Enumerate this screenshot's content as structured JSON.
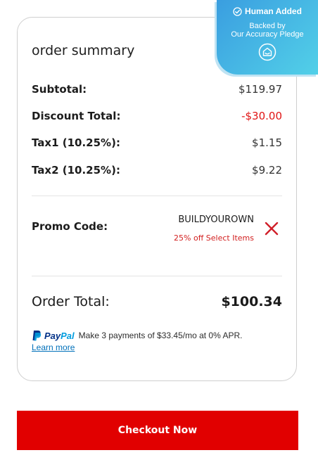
{
  "summary": {
    "title": "order summary",
    "subtotal_label": "Subtotal:",
    "subtotal_value": "$119.97",
    "discount_label": "Discount Total:",
    "discount_value": "-$30.00",
    "tax1_label": "Tax1 (10.25%):",
    "tax1_value": "$1.15",
    "tax2_label": "Tax2 (10.25%):",
    "tax2_value": "$9.22"
  },
  "promo": {
    "label": "Promo Code:",
    "code": "BUILDYOUROWN",
    "description": "25% off Select Items",
    "remove_icon": "close-icon"
  },
  "total": {
    "label": "Order Total:",
    "value": "$100.34"
  },
  "paypal": {
    "brand_part1": "Pay",
    "brand_part2": "Pal",
    "message": "Make 3 payments of $33.45/mo at 0% APR.",
    "learn_more": "Learn more"
  },
  "checkout": {
    "label": "Checkout Now"
  },
  "badge": {
    "title": "Human Added",
    "line1": "Backed by",
    "line2": "Our Accuracy Pledge"
  },
  "colors": {
    "accent_red": "#e10000",
    "discount_red": "#e01414",
    "badge_blue": "#3a9ee0",
    "paypal_dark": "#003087",
    "paypal_light": "#009cde"
  }
}
